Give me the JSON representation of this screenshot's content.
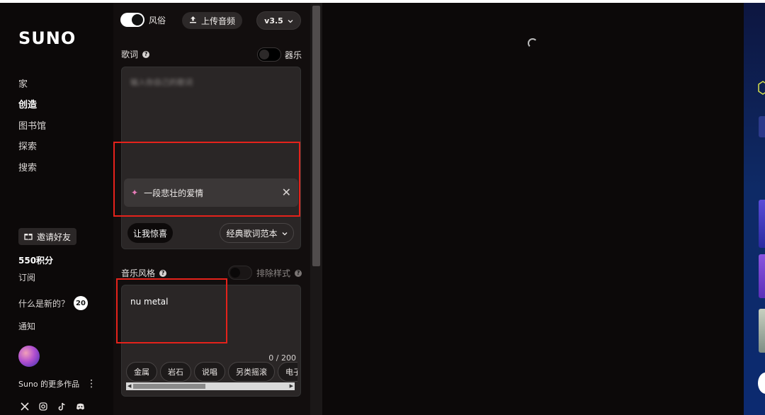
{
  "brand": {
    "logo": "SUNO"
  },
  "nav": {
    "items": [
      {
        "label": "家"
      },
      {
        "label": "创造"
      },
      {
        "label": "图书馆"
      },
      {
        "label": "探索"
      },
      {
        "label": "搜索"
      }
    ]
  },
  "sidebar": {
    "invite_label": "邀请好友",
    "credits": "550积分",
    "subscribe": "订阅",
    "whats_new": "什么是新的？",
    "whats_new_count": "20",
    "notifications": "通知",
    "more_from": "Suno 的更多作品"
  },
  "create": {
    "style_toggle_label": "风俗",
    "upload_label": "上传音频",
    "version": "v3.5",
    "lyrics_title": "歌词",
    "instrumental_label": "器乐",
    "lyrics_placeholder": "输入你自己的歌词",
    "prompt_text": "一段悲壮的爱情",
    "surprise_label": "让我惊喜",
    "classic_label": "经典歌词范本",
    "style_title": "音乐风格",
    "exclude_label": "排除样式",
    "style_value": "nu metal",
    "char_count": "0 / 200",
    "chips": [
      "金属",
      "岩石",
      "说唱",
      "另类摇滚",
      "电子舞"
    ]
  },
  "colors": {
    "highlight_box": "#e5221b",
    "background": "#0d0a0a",
    "panel": "#2a2626"
  }
}
